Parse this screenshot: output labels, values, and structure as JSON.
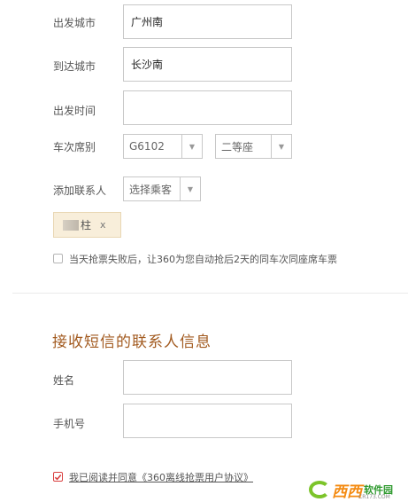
{
  "form": {
    "departure_label": "出发城市",
    "departure_value": "广州南",
    "arrival_label": "到达城市",
    "arrival_value": "长沙南",
    "time_label": "出发时间",
    "time_value": "",
    "train_label": "车次席别",
    "train_value": "G6102",
    "seat_value": "二等座",
    "contact_label": "添加联系人",
    "contact_select": "选择乘客",
    "passenger_name_visible": "柱",
    "passenger_remove": "x",
    "auto_grab_text": "当天抢票失败后，让360为您自动抢后2天的同车次同座席车票",
    "auto_grab_checked": false
  },
  "sms": {
    "section_title": "接收短信的联系人信息",
    "name_label": "姓名",
    "name_value": "",
    "phone_label": "手机号",
    "phone_value": ""
  },
  "agreement": {
    "text": "我已阅读并同意《360离线抢票用户协议》",
    "checked": true
  },
  "watermark": {
    "brand": "西西",
    "suffix": "软件园",
    "domain": "CR173.COM"
  },
  "colors": {
    "section_title": "#a25a1f",
    "chip_bg": "#f8eeda",
    "check_red": "#d94040",
    "logo_green": "#7cc42a",
    "logo_orange": "#f48b12"
  },
  "icons": {
    "dropdown": "chevron-down-icon",
    "checkmark": "check-icon",
    "logo": "cr173-logo-icon"
  }
}
